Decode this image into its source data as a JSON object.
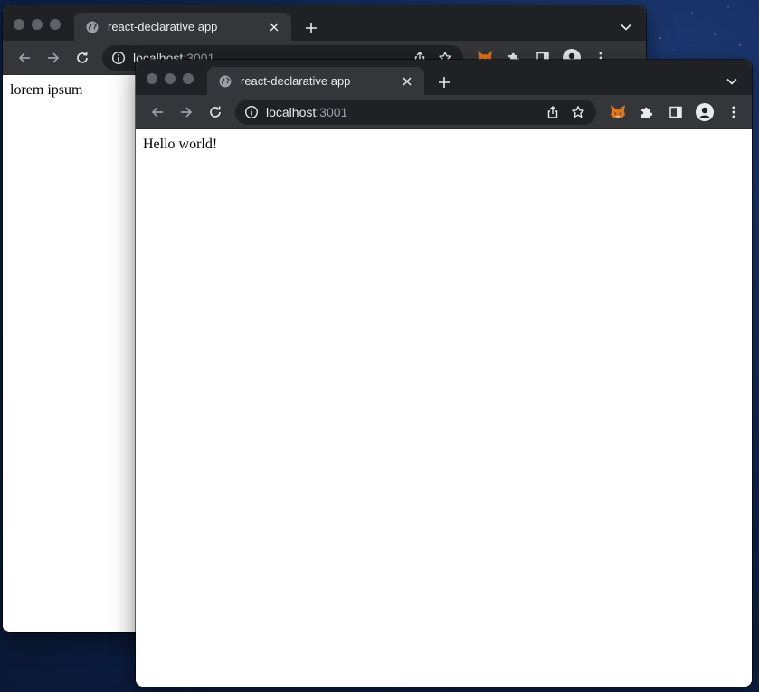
{
  "windows": {
    "back": {
      "tab": {
        "title": "react-declarative app",
        "icon": "globe-icon"
      },
      "address": {
        "host": "localhost",
        "port": ":3001"
      },
      "content": {
        "text": "lorem ipsum"
      }
    },
    "front": {
      "tab": {
        "title": "react-declarative app",
        "icon": "globe-icon"
      },
      "address": {
        "host": "localhost",
        "port": ":3001"
      },
      "content": {
        "text": "Hello world!"
      }
    }
  },
  "colors": {
    "tabbar": "#202124",
    "toolbar": "#35363a",
    "omnibox": "#202124",
    "text_light": "#e8eaed",
    "text_dim": "#9aa0a6",
    "metamask_orange": "#f6851b",
    "desktop": "#102650"
  }
}
